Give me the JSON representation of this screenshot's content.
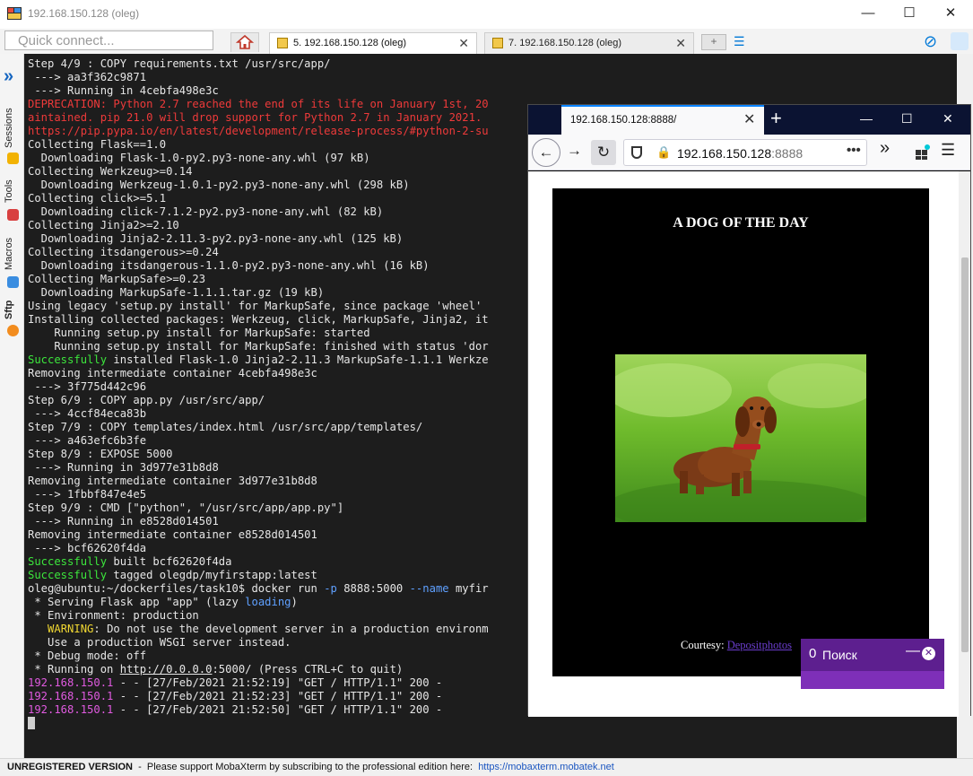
{
  "window": {
    "title": "192.168.150.128 (oleg)",
    "minimize": "—",
    "maximize": "☐",
    "close": "✕"
  },
  "toolbar": {
    "quick_connect_placeholder": "Quick connect...",
    "tabs": [
      {
        "label": "5. 192.168.150.128 (oleg)",
        "close": "✕"
      },
      {
        "label": "7. 192.168.150.128 (oleg)",
        "close": "✕"
      }
    ],
    "new_tab": "+",
    "menu": "☰",
    "attach": "⊘"
  },
  "sidebar": {
    "expand": "»",
    "items": [
      "Sessions",
      "Tools",
      "Macros",
      "Sftp"
    ]
  },
  "terminal": {
    "lines": [
      [
        {
          "t": "Step 4/9 : COPY requirements.txt /usr/src/app/"
        }
      ],
      [
        {
          "t": " ---> aa3f362c9871"
        }
      ],
      [
        {
          "t": " ---> Running in 4cebfa498e3c"
        }
      ],
      [
        {
          "t": "DEPRECATION: Python 2.7 reached the end of its life on January 1st, 20",
          "c": "red"
        }
      ],
      [
        {
          "t": "aintained. pip 21.0 will drop support for Python 2.7 in January 2021.",
          "c": "red"
        }
      ],
      [
        {
          "t": "https://pip.pypa.io/en/latest/development/release-process/#python-2-su",
          "c": "red"
        }
      ],
      [
        {
          "t": "Collecting Flask==1.0"
        }
      ],
      [
        {
          "t": "  Downloading Flask-1.0-py2.py3-none-any.whl (97 kB)"
        }
      ],
      [
        {
          "t": "Collecting Werkzeug>=0.14"
        }
      ],
      [
        {
          "t": "  Downloading Werkzeug-1.0.1-py2.py3-none-any.whl (298 kB)"
        }
      ],
      [
        {
          "t": "Collecting click>=5.1"
        }
      ],
      [
        {
          "t": "  Downloading click-7.1.2-py2.py3-none-any.whl (82 kB)"
        }
      ],
      [
        {
          "t": "Collecting Jinja2>=2.10"
        }
      ],
      [
        {
          "t": "  Downloading Jinja2-2.11.3-py2.py3-none-any.whl (125 kB)"
        }
      ],
      [
        {
          "t": "Collecting itsdangerous>=0.24"
        }
      ],
      [
        {
          "t": "  Downloading itsdangerous-1.1.0-py2.py3-none-any.whl (16 kB)"
        }
      ],
      [
        {
          "t": "Collecting MarkupSafe>=0.23"
        }
      ],
      [
        {
          "t": "  Downloading MarkupSafe-1.1.1.tar.gz (19 kB)"
        }
      ],
      [
        {
          "t": "Using legacy 'setup.py install' for MarkupSafe, since package 'wheel'"
        }
      ],
      [
        {
          "t": "Installing collected packages: Werkzeug, click, MarkupSafe, Jinja2, it"
        }
      ],
      [
        {
          "t": "    Running setup.py install for MarkupSafe: started"
        }
      ],
      [
        {
          "t": "    Running setup.py install for MarkupSafe: finished with status 'dor"
        }
      ],
      [
        {
          "t": "Successfully",
          "c": "green"
        },
        {
          "t": " installed Flask-1.0 Jinja2-2.11.3 MarkupSafe-1.1.1 Werkze"
        }
      ],
      [
        {
          "t": "Removing intermediate container 4cebfa498e3c"
        }
      ],
      [
        {
          "t": " ---> 3f775d442c96"
        }
      ],
      [
        {
          "t": "Step 6/9 : COPY app.py /usr/src/app/"
        }
      ],
      [
        {
          "t": " ---> 4ccf84eca83b"
        }
      ],
      [
        {
          "t": "Step 7/9 : COPY templates/index.html /usr/src/app/templates/"
        }
      ],
      [
        {
          "t": " ---> a463efc6b3fe"
        }
      ],
      [
        {
          "t": "Step 8/9 : EXPOSE 5000"
        }
      ],
      [
        {
          "t": " ---> Running in 3d977e31b8d8"
        }
      ],
      [
        {
          "t": "Removing intermediate container 3d977e31b8d8"
        }
      ],
      [
        {
          "t": " ---> 1fbbf847e4e5"
        }
      ],
      [
        {
          "t": "Step 9/9 : CMD [\"python\", \"/usr/src/app/app.py\"]"
        }
      ],
      [
        {
          "t": " ---> Running in e8528d014501"
        }
      ],
      [
        {
          "t": "Removing intermediate container e8528d014501"
        }
      ],
      [
        {
          "t": " ---> bcf62620f4da"
        }
      ],
      [
        {
          "t": "Successfully",
          "c": "green"
        },
        {
          "t": " built bcf62620f4da"
        }
      ],
      [
        {
          "t": "Successfully",
          "c": "green"
        },
        {
          "t": " tagged olegdp/myfirstapp:latest"
        }
      ],
      [
        {
          "t": "oleg@ubuntu:~/dockerfiles/task10$ docker run "
        },
        {
          "t": "-p",
          "c": "blue"
        },
        {
          "t": " 8888:5000 "
        },
        {
          "t": "--name",
          "c": "blue"
        },
        {
          "t": " myfir"
        }
      ],
      [
        {
          "t": " * Serving Flask app \"app\" (lazy "
        },
        {
          "t": "loading",
          "c": "blue"
        },
        {
          "t": ")"
        }
      ],
      [
        {
          "t": " * Environment: production"
        }
      ],
      [
        {
          "t": "   "
        },
        {
          "t": "WARNING",
          "c": "yellow"
        },
        {
          "t": ": Do not use the development server in a production environm"
        }
      ],
      [
        {
          "t": "   Use a production WSGI server instead."
        }
      ],
      [
        {
          "t": " * Debug mode: off"
        }
      ],
      [
        {
          "t": " * Running on "
        },
        {
          "t": "http://0.0.0.0",
          "c": "link"
        },
        {
          "t": ":5000/ (Press CTRL+C to quit)"
        }
      ],
      [
        {
          "t": "192.168.150.1",
          "c": "mag"
        },
        {
          "t": " - - [27/Feb/2021 21:52:19] \"GET / HTTP/1.1\" 200 -"
        }
      ],
      [
        {
          "t": "192.168.150.1",
          "c": "mag"
        },
        {
          "t": " - - [27/Feb/2021 21:52:23] \"GET / HTTP/1.1\" 200 -"
        }
      ],
      [
        {
          "t": "192.168.150.1",
          "c": "mag"
        },
        {
          "t": " - - [27/Feb/2021 21:52:50] \"GET / HTTP/1.1\" 200 -"
        }
      ]
    ]
  },
  "status": {
    "unregistered": "UNREGISTERED VERSION",
    "message": "  -  Please support MobaXterm by subscribing to the professional edition here:  ",
    "link": "https://mobaxterm.mobatek.net"
  },
  "firefox": {
    "tab_title": "192.168.150.128:8888/",
    "tab_close": "✕",
    "new_tab": "+",
    "minimize": "—",
    "maximize": "☐",
    "close": "✕",
    "url_host": "192.168.150.128",
    "url_port": ":8888",
    "page_actions": "•••",
    "overflow": "»",
    "menu": "☰",
    "page": {
      "title": "A DOG OF THE DAY",
      "courtesy_label": "Courtesy: ",
      "courtesy_link": "Depositphotos"
    }
  },
  "search_popup": {
    "count": "0",
    "label": "Поиск",
    "minimize": "—",
    "close": "✕"
  }
}
